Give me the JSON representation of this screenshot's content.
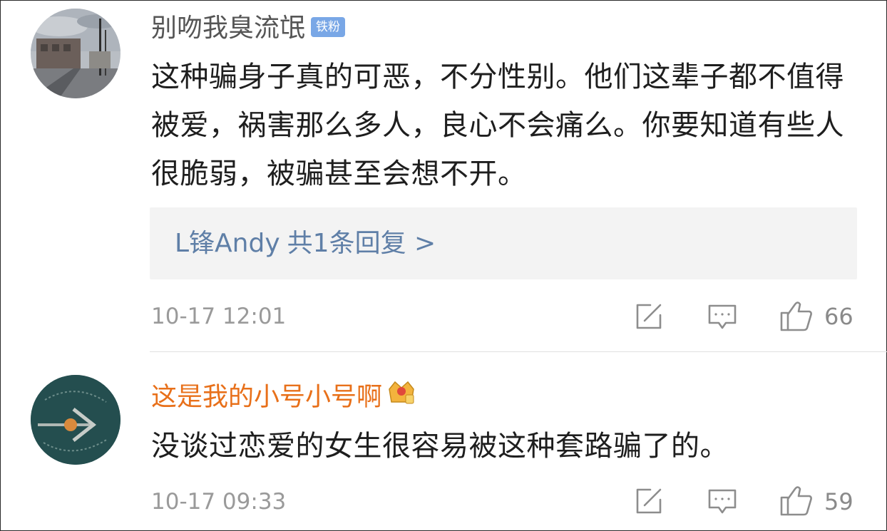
{
  "comments": [
    {
      "username": "别吻我臭流氓",
      "badge": "铁粉",
      "text": "这种骗身子真的可恶，不分性别。他们这辈子都不值得被爱，祸害那么多人，良心不会痛么。你要知道有些人很脆弱，被骗甚至会想不开。",
      "reply": {
        "author": "L锋Andy",
        "summary": "共1条回复 >"
      },
      "time": "10-17 12:01",
      "likes": "66",
      "icons": [
        "share-edit-icon",
        "comment-icon",
        "thumbs-up-icon"
      ]
    },
    {
      "username": "这是我的小号小号啊",
      "badge_icon": "vip-crown-icon",
      "text": "没谈过恋爱的女生很容易被这种套路骗了的。",
      "time": "10-17 09:33",
      "likes": "59",
      "icons": [
        "share-edit-icon",
        "comment-icon",
        "thumbs-up-icon"
      ]
    }
  ],
  "colors": {
    "username_normal": "#555555",
    "username_vip": "#e8701a",
    "reply_link": "#5f7fa7",
    "badge_bg": "#79a7e6",
    "meta_text": "#9a9a9a"
  }
}
